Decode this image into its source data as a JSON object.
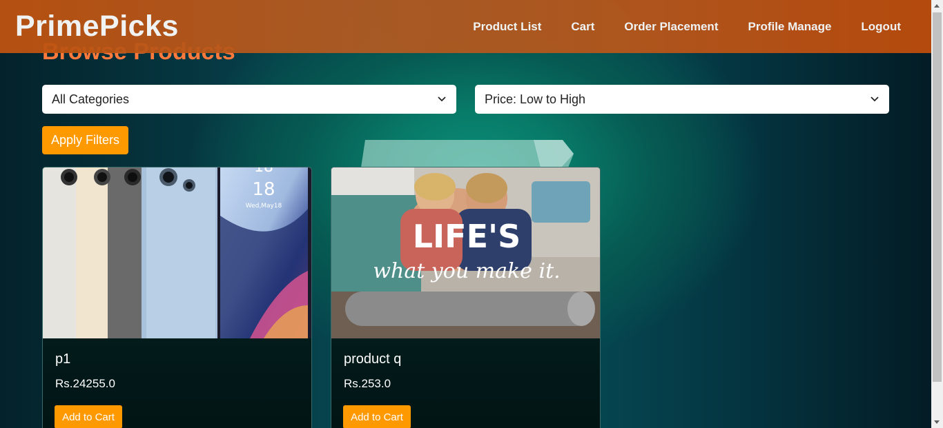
{
  "brand": "PrimePicks",
  "nav": [
    {
      "label": "Product List"
    },
    {
      "label": "Cart"
    },
    {
      "label": "Order Placement"
    },
    {
      "label": "Profile Manage"
    },
    {
      "label": "Logout"
    }
  ],
  "page_title": "Browse Products",
  "filters": {
    "category_value": "All Categories",
    "sort_value": "Price: Low to High",
    "apply_label": "Apply Filters"
  },
  "products": [
    {
      "name": "p1",
      "price": "Rs.24255.0",
      "add_label": "Add to Cart",
      "image_text": [
        "18",
        "18",
        "Wed,May18"
      ]
    },
    {
      "name": "product q",
      "price": "Rs.253.0",
      "add_label": "Add to Cart",
      "image_text": [
        "LIFE'S",
        "what you make it."
      ]
    }
  ],
  "colors": {
    "header": "#b9561a",
    "accent": "#ff9900",
    "title": "#ff7a3c"
  }
}
